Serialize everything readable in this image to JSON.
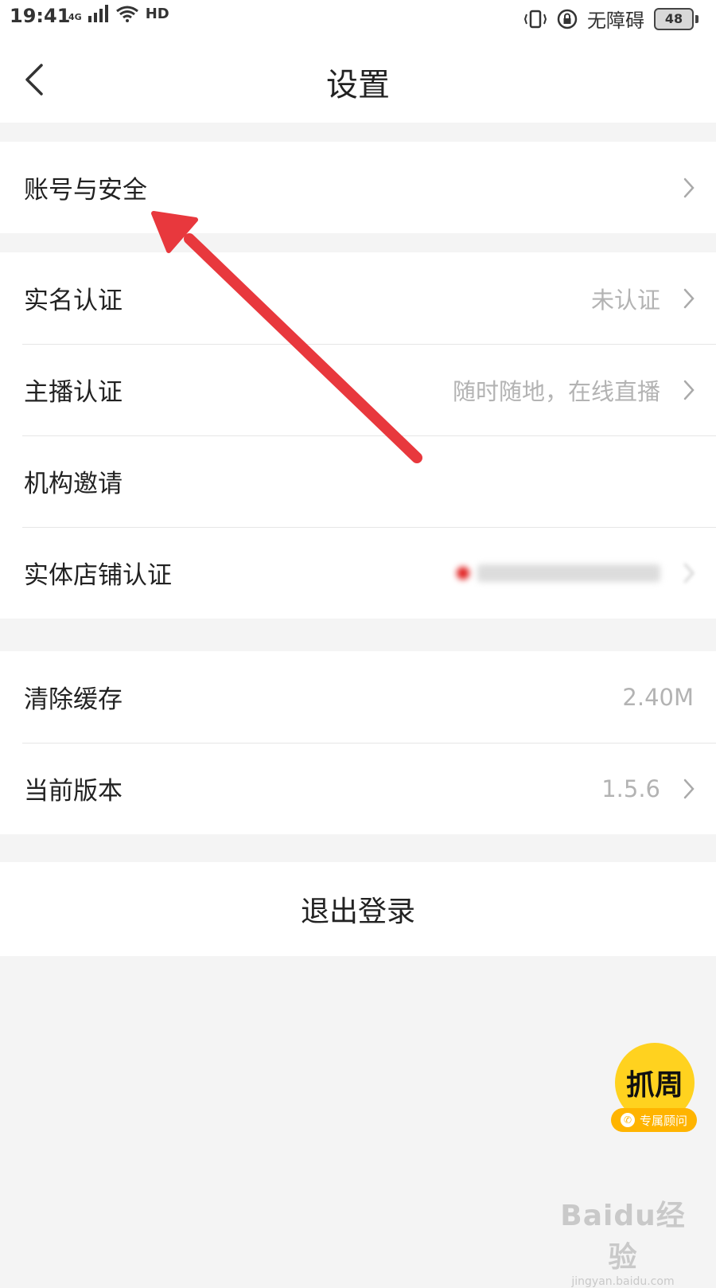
{
  "status_bar": {
    "time": "19:41",
    "network": "4G",
    "hd": "HD",
    "accessibility": "无障碍",
    "battery": "48"
  },
  "header": {
    "title": "设置"
  },
  "groups": [
    {
      "items": [
        {
          "label": "账号与安全",
          "value": "",
          "has_arrow": true
        }
      ]
    },
    {
      "items": [
        {
          "label": "实名认证",
          "value": "未认证",
          "has_arrow": true
        },
        {
          "label": "主播认证",
          "value": "随时随地，在线直播",
          "has_arrow": true
        },
        {
          "label": "机构邀请",
          "value": "",
          "has_arrow": false
        },
        {
          "label": "实体店铺认证",
          "value": "",
          "has_arrow": true,
          "blurred": true
        }
      ]
    },
    {
      "items": [
        {
          "label": "清除缓存",
          "value": "2.40M",
          "has_arrow": false
        },
        {
          "label": "当前版本",
          "value": "1.5.6",
          "has_arrow": true
        }
      ]
    }
  ],
  "logout_label": "退出登录",
  "advisor": {
    "logo_text": "抓周",
    "label": "专属顾问"
  },
  "watermark": {
    "main": "Baidu经验",
    "sub": "jingyan.baidu.com"
  },
  "colors": {
    "annotation_arrow": "#e8383d",
    "advisor_yellow": "#ffd21f"
  }
}
